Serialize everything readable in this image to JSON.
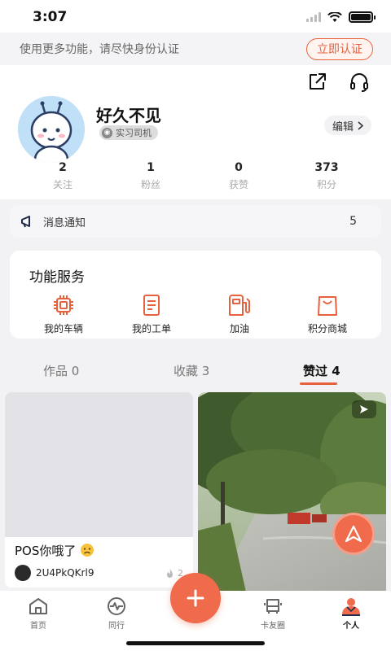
{
  "status_bar": {
    "time": "3:07"
  },
  "verify_banner": {
    "text": "使用更多功能，请尽快身份认证",
    "button_label": "立即认证"
  },
  "profile": {
    "name": "好久不见",
    "badge": "实习司机",
    "edit_label": "编辑",
    "stats": [
      {
        "value": "2",
        "label": "关注"
      },
      {
        "value": "1",
        "label": "粉丝"
      },
      {
        "value": "0",
        "label": "获赞"
      },
      {
        "value": "373",
        "label": "积分"
      }
    ]
  },
  "notice": {
    "label": "消息通知",
    "count": "5"
  },
  "services": {
    "title": "功能服务",
    "items": [
      {
        "label": "我的车辆",
        "icon": "chip-icon"
      },
      {
        "label": "我的工单",
        "icon": "document-icon"
      },
      {
        "label": "加油",
        "icon": "fuel-pump-icon"
      },
      {
        "label": "积分商城",
        "icon": "shopping-bag-icon"
      }
    ]
  },
  "tabs": [
    {
      "label": "作品 0"
    },
    {
      "label": "收藏 3"
    },
    {
      "label": "赞过 4"
    }
  ],
  "feed": {
    "card_left": {
      "title": "POS你哦了",
      "author": "2U4PkQKrl9",
      "likes": "2"
    }
  },
  "bottom_nav": [
    {
      "label": "首页",
      "icon": "home-icon"
    },
    {
      "label": "同行",
      "icon": "pulse-icon"
    },
    {
      "label": "卡友圈",
      "icon": "truck-icon"
    },
    {
      "label": "个人",
      "icon": "person-icon"
    }
  ],
  "colors": {
    "accent": "#e8613f",
    "active_tab_underline": "#e8613f"
  }
}
